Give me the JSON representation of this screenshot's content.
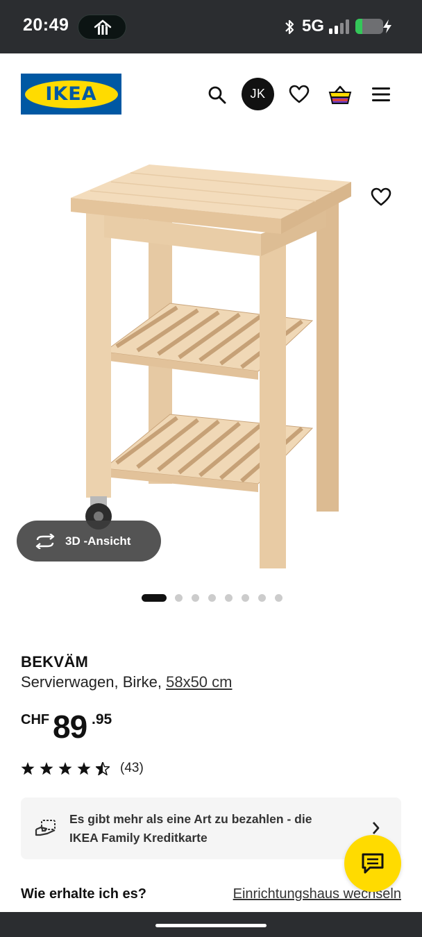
{
  "status_bar": {
    "time": "20:49",
    "network": "5G",
    "battery_level": 0.25,
    "icons": [
      "activity-pill-icon",
      "bluetooth-icon",
      "signal-icon",
      "battery-icon",
      "charging-bolt-icon"
    ]
  },
  "header": {
    "logo_text": "IKEA",
    "avatar_initials": "JK",
    "icons": [
      "search-icon",
      "heart-icon",
      "shopping-bag-icon",
      "menu-icon"
    ]
  },
  "gallery": {
    "view_3d_label": "3D -Ansicht",
    "dots_total": 8,
    "active_dot": 1
  },
  "product": {
    "name": "BEKVÄM",
    "description": "Servierwagen, Birke, ",
    "size_link": "58x50 cm",
    "price": {
      "currency": "CHF",
      "integer": "89",
      "decimal": ".95"
    },
    "rating": {
      "stars": 4.5,
      "count": "(43)"
    }
  },
  "promo": {
    "line1": "Es gibt mehr als eine Art zu bezahlen - die",
    "line2": "IKEA Family Kreditkarte"
  },
  "delivery": {
    "title": "Wie erhalte ich es?",
    "store_link": "Einrichtungshaus wechseln"
  },
  "colors": {
    "ikea_blue": "#0058a3",
    "ikea_yellow": "#ffdb00",
    "status_bar_bg": "#2b2d30",
    "battery_green": "#34c759"
  }
}
